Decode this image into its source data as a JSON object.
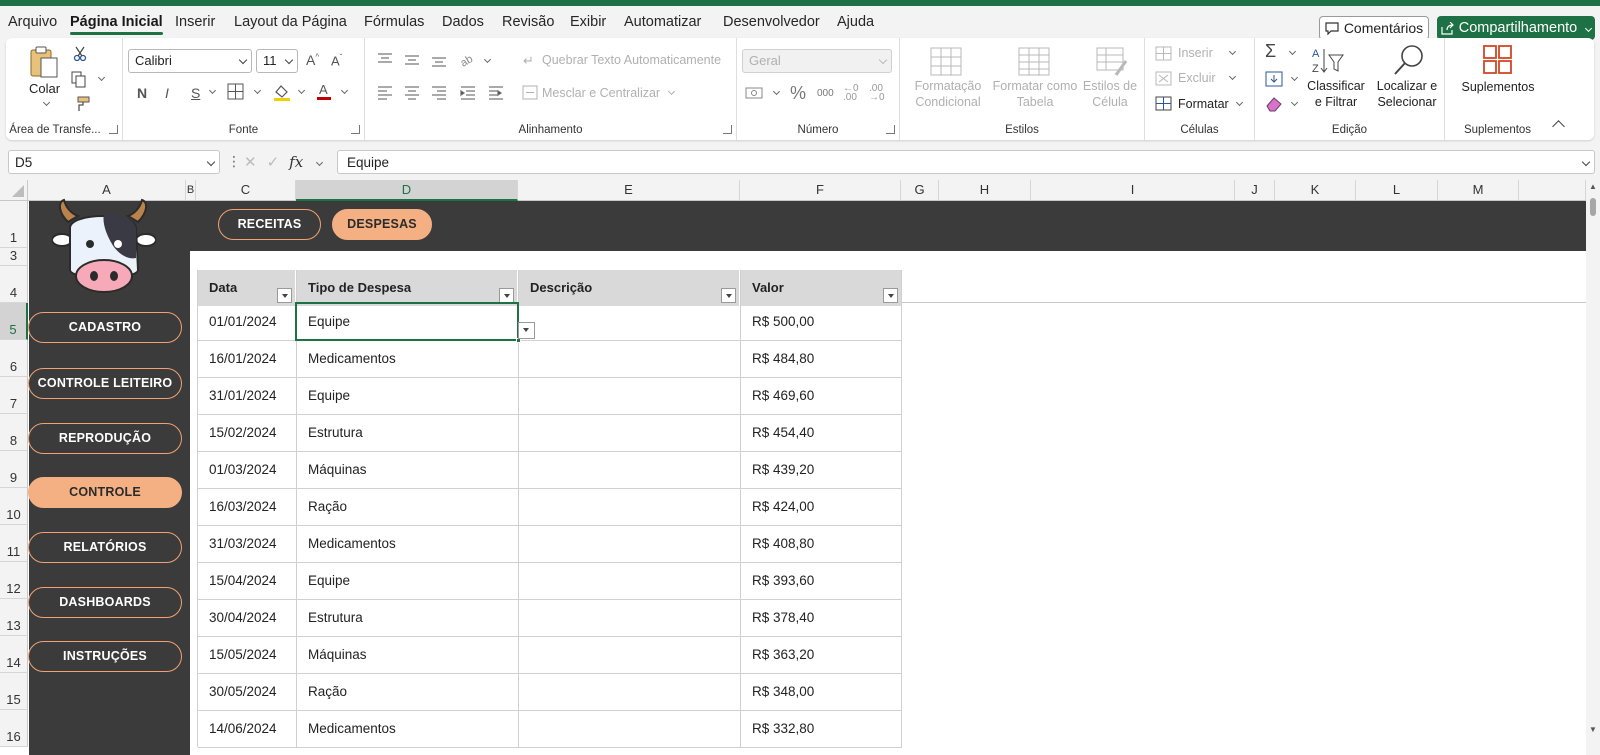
{
  "menu": {
    "tabs": [
      "Arquivo",
      "Página Inicial",
      "Inserir",
      "Layout da Página",
      "Fórmulas",
      "Dados",
      "Revisão",
      "Exibir",
      "Automatizar",
      "Desenvolvedor",
      "Ajuda"
    ],
    "active_tab": "Página Inicial",
    "comments_label": "Comentários",
    "share_label": "Compartilhamento"
  },
  "ribbon": {
    "clipboard": {
      "paste_label": "Colar",
      "group_label": "Área de Transfe..."
    },
    "font": {
      "family": "Calibri",
      "size": "11",
      "bold": "N",
      "italic": "I",
      "underline": "S",
      "group_label": "Fonte"
    },
    "alignment": {
      "wrap_label": "Quebrar Texto Automaticamente",
      "merge_label": "Mesclar e Centralizar",
      "group_label": "Alinhamento"
    },
    "number": {
      "format": "Geral",
      "percent": "%",
      "thousands": "000",
      "group_label": "Número"
    },
    "styles": {
      "conditional_line1": "Formatação",
      "conditional_line2": "Condicional",
      "table_line1": "Formatar como",
      "table_line2": "Tabela",
      "cell_line1": "Estilos de",
      "cell_line2": "Célula",
      "group_label": "Estilos"
    },
    "cells": {
      "insert_label": "Inserir",
      "delete_label": "Excluir",
      "format_label": "Formatar",
      "group_label": "Células"
    },
    "editing": {
      "sort_line1": "Classificar",
      "sort_line2": "e Filtrar",
      "find_line1": "Localizar e",
      "find_line2": "Selecionar",
      "group_label": "Edição"
    },
    "addins": {
      "label": "Suplementos",
      "group_label": "Suplementos"
    }
  },
  "formula_bar": {
    "name_box": "D5",
    "formula": "Equipe"
  },
  "columns": [
    "A",
    "B",
    "C",
    "D",
    "E",
    "F",
    "G",
    "H",
    "I",
    "J",
    "K",
    "L",
    "M"
  ],
  "rows": [
    "1",
    "3",
    "4",
    "5",
    "6",
    "7",
    "8",
    "9",
    "10",
    "11",
    "12",
    "13",
    "14",
    "15",
    "16"
  ],
  "selected_cell": {
    "column": "D",
    "row": "5"
  },
  "sheet": {
    "top_buttons": [
      {
        "label": "RECEITAS",
        "active": false
      },
      {
        "label": "DESPESAS",
        "active": true
      }
    ],
    "nav_buttons": [
      {
        "label": "CADASTRO",
        "active": false
      },
      {
        "label": "CONTROLE LEITEIRO",
        "active": false
      },
      {
        "label": "REPRODUÇÃO",
        "active": false
      },
      {
        "label": "CONTROLE",
        "active": true
      },
      {
        "label": "RELATÓRIOS",
        "active": false
      },
      {
        "label": "DASHBOARDS",
        "active": false
      },
      {
        "label": "INSTRUÇÕES",
        "active": false
      }
    ],
    "table_headers": [
      "Data",
      "Tipo de Despesa",
      "Descrição",
      "Valor"
    ],
    "table_rows": [
      [
        "01/01/2024",
        "Equipe",
        "",
        "R$ 500,00"
      ],
      [
        "16/01/2024",
        "Medicamentos",
        "",
        "R$ 484,80"
      ],
      [
        "31/01/2024",
        "Equipe",
        "",
        "R$ 469,60"
      ],
      [
        "15/02/2024",
        "Estrutura",
        "",
        "R$ 454,40"
      ],
      [
        "01/03/2024",
        "Máquinas",
        "",
        "R$ 439,20"
      ],
      [
        "16/03/2024",
        "Ração",
        "",
        "R$ 424,00"
      ],
      [
        "31/03/2024",
        "Medicamentos",
        "",
        "R$ 408,80"
      ],
      [
        "15/04/2024",
        "Equipe",
        "",
        "R$ 393,60"
      ],
      [
        "30/04/2024",
        "Estrutura",
        "",
        "R$ 378,40"
      ],
      [
        "15/05/2024",
        "Máquinas",
        "",
        "R$ 363,20"
      ],
      [
        "30/05/2024",
        "Ração",
        "",
        "R$ 348,00"
      ],
      [
        "14/06/2024",
        "Medicamentos",
        "",
        "R$ 332,80"
      ]
    ]
  },
  "colors": {
    "accent": "#1e7145",
    "dark_panel": "#3b3b3b",
    "button_orange": "#f4b083",
    "table_header": "#d9d9d9"
  },
  "icons": [
    "paste-icon",
    "cut-icon",
    "copy-icon",
    "format-painter-icon",
    "autosum-icon",
    "sort-filter-icon",
    "find-icon",
    "addins-icon",
    "cow-logo"
  ]
}
